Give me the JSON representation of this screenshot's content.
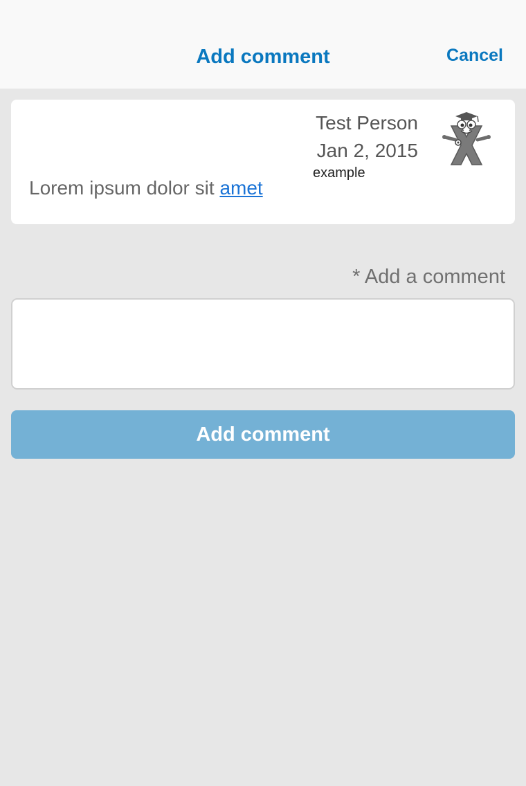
{
  "header": {
    "title": "Add comment",
    "cancel_label": "Cancel"
  },
  "comment": {
    "author": "Test Person",
    "date": "Jan 2, 2015",
    "role": "example",
    "text": "Lorem ipsum dolor sit ",
    "link_text": "amet",
    "avatar_icon": "graduate-x-mascot-icon"
  },
  "form": {
    "label": "* Add a comment",
    "input_value": "",
    "input_placeholder": "",
    "submit_label": "Add comment"
  },
  "colors": {
    "accent": "#0a78bf",
    "link": "#1a73d6",
    "button_disabled": "#74b1d5",
    "background": "#e7e7e7",
    "header_bg": "#f9f9f9"
  }
}
